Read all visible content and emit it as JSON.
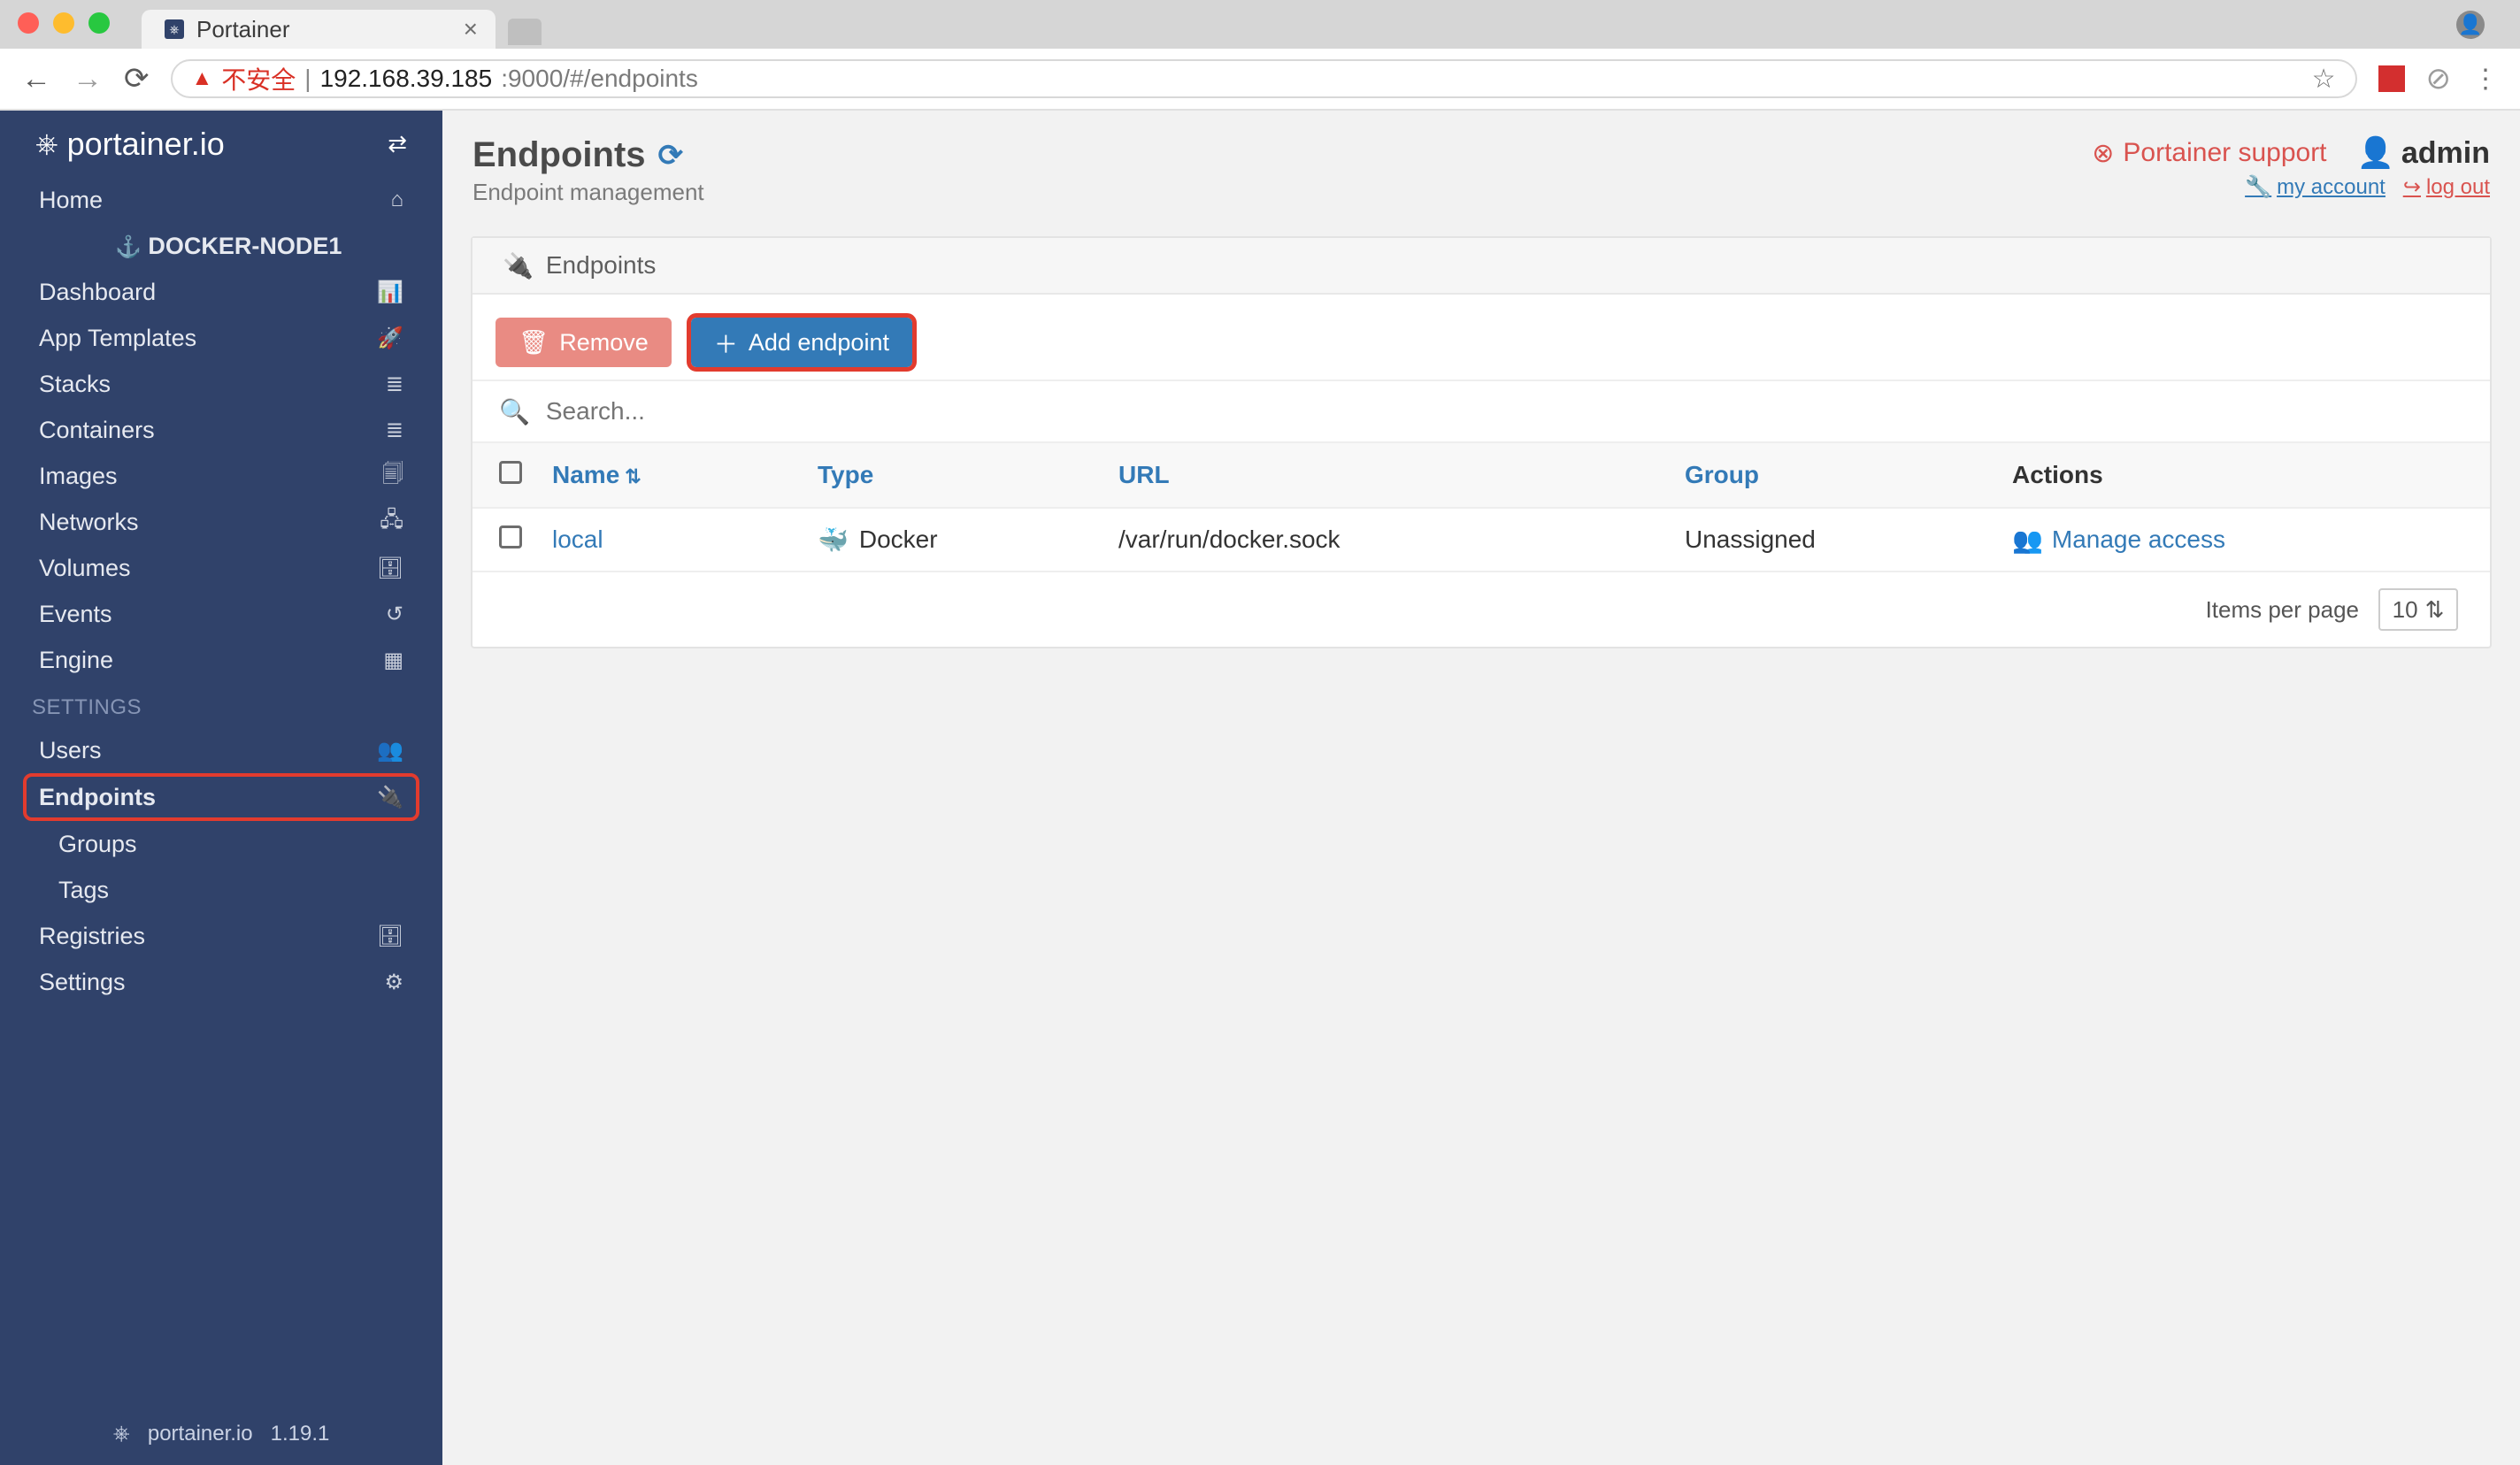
{
  "browser": {
    "tab_title": "Portainer",
    "url_secure_warn": "不安全",
    "url_host": "192.168.39.185",
    "url_rest": ":9000/#/endpoints"
  },
  "sidebar": {
    "brand": "portainer.io",
    "version": "1.19.1",
    "items": [
      {
        "label": "Home",
        "icon": "⌂"
      },
      {
        "label": "DOCKER-NODE1",
        "icon": "⚓",
        "sub": true
      },
      {
        "label": "Dashboard",
        "icon": "📊"
      },
      {
        "label": "App Templates",
        "icon": "🚀"
      },
      {
        "label": "Stacks",
        "icon": "≣"
      },
      {
        "label": "Containers",
        "icon": "≣"
      },
      {
        "label": "Images",
        "icon": "🗐"
      },
      {
        "label": "Networks",
        "icon": "🖧"
      },
      {
        "label": "Volumes",
        "icon": "🗄"
      },
      {
        "label": "Events",
        "icon": "↺"
      },
      {
        "label": "Engine",
        "icon": "▦"
      }
    ],
    "settings_header": "SETTINGS",
    "settings": [
      {
        "label": "Users",
        "icon": "👥"
      },
      {
        "label": "Endpoints",
        "icon": "🔌",
        "hl": true
      },
      {
        "label": "Groups",
        "sub": true
      },
      {
        "label": "Tags",
        "sub": true
      },
      {
        "label": "Registries",
        "icon": "🗄"
      },
      {
        "label": "Settings",
        "icon": "⚙"
      }
    ]
  },
  "header": {
    "title": "Endpoints",
    "subtitle": "Endpoint management",
    "support": "Portainer support",
    "user": "admin",
    "my_account": "my account",
    "logout": "log out"
  },
  "widget": {
    "title": "Endpoints",
    "remove": "Remove",
    "add": "Add endpoint",
    "search_ph": "Search...",
    "cols": {
      "name": "Name",
      "type": "Type",
      "url": "URL",
      "group": "Group",
      "actions": "Actions"
    },
    "rows": [
      {
        "name": "local",
        "type": "Docker",
        "url": "/var/run/docker.sock",
        "group": "Unassigned",
        "action": "Manage access"
      }
    ],
    "ipp_label": "Items per page",
    "ipp_value": "10"
  }
}
